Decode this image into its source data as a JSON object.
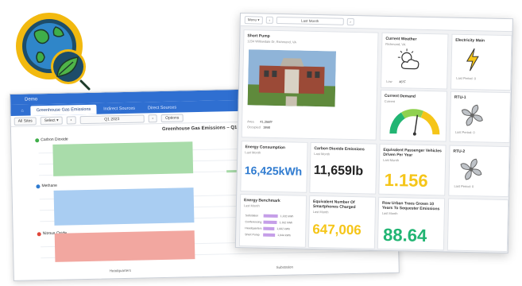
{
  "colors": {
    "chrome_blue": "#2f6fd1",
    "co2": "#a9dcaa",
    "methane": "#a9cdf2",
    "nitrous": "#f2a7a0",
    "energy_blue": "#2f7bd0",
    "yellow": "#f5c518",
    "green": "#22b573",
    "bolt": "#f5c518"
  },
  "emissions_window": {
    "app_name": "Demo",
    "tabs": [
      "Greenhouse Gas Emissions",
      "Indirect Sources",
      "Direct Sources"
    ],
    "toolbar": {
      "all_sites": "All Sites",
      "select": "Select ▾",
      "period": "Q1 2023",
      "options": "Options"
    },
    "chart_title": "Greenhouse Gas Emissions – Q1 20",
    "series_labels": [
      "Carbon Dioxide",
      "Methane",
      "Nitrous Oxide"
    ],
    "x_labels": [
      "Headquarters",
      "Substation"
    ]
  },
  "chart_data": {
    "type": "bar",
    "title": "Greenhouse Gas Emissions – Q1 20",
    "categories": [
      "Headquarters",
      "Substation"
    ],
    "series": [
      {
        "name": "Carbon Dioxide",
        "values": [
          1.0,
          0.07
        ]
      },
      {
        "name": "Methane",
        "values": [
          1.0,
          0.0
        ]
      },
      {
        "name": "Nitrous Oxide",
        "values": [
          1.0,
          0.0
        ]
      }
    ]
  },
  "dashboard": {
    "toolbar": {
      "menu": "Menu ▾",
      "period": "Last Month"
    },
    "short_pump": {
      "title": "Short Pump",
      "address": "1234 Willowdale Dr, Richmond, VA",
      "area_label": "Area",
      "area_value": "41,356ft²",
      "occupied_label": "Occupied",
      "occupied_value": "1998"
    },
    "weather": {
      "title": "Current Weather",
      "location": "Richmond, VA",
      "low_label": "Low",
      "temp": "46°F"
    },
    "demand": {
      "title": "Current Demand",
      "subtitle": "Current"
    },
    "meter_main": {
      "title": "Electricity Main",
      "sub": "Last Period: 0"
    },
    "rtu1": {
      "title": "RTU-1",
      "sub": "Last Period: 0"
    },
    "rtu2": {
      "title": "RTU-2",
      "sub": "Last Period: 0"
    },
    "energy": {
      "title": "Energy Consumption",
      "sub": "Last Month",
      "value": "16,425kWh"
    },
    "co2": {
      "title": "Carbon Dioxide Emissions",
      "sub": "Last Month",
      "value": "11,659lb"
    },
    "vehicles": {
      "title": "Equivalent Passenger Vehicles Driven Per Year",
      "sub": "Last Month",
      "value": "1.156"
    },
    "benchmark": {
      "title": "Energy Benchmark",
      "sub": "Last Month",
      "rows": [
        {
          "label": "Substation",
          "value": "1,182 kWh"
        },
        {
          "label": "Conferencing",
          "value": "1,162 kWh"
        },
        {
          "label": "Headquarters",
          "value": "1,002 kWh"
        },
        {
          "label": "Short Pump",
          "value": "1,044 kWh"
        }
      ]
    },
    "smartphones": {
      "title": "Equivalent Number Of Smartphones Charged",
      "sub": "Last Month",
      "value": "647,006"
    },
    "trees": {
      "title": "Row Urban Trees Grown 10 Years To Sequester Emissions",
      "sub": "Last Month",
      "value": "88.64"
    }
  }
}
